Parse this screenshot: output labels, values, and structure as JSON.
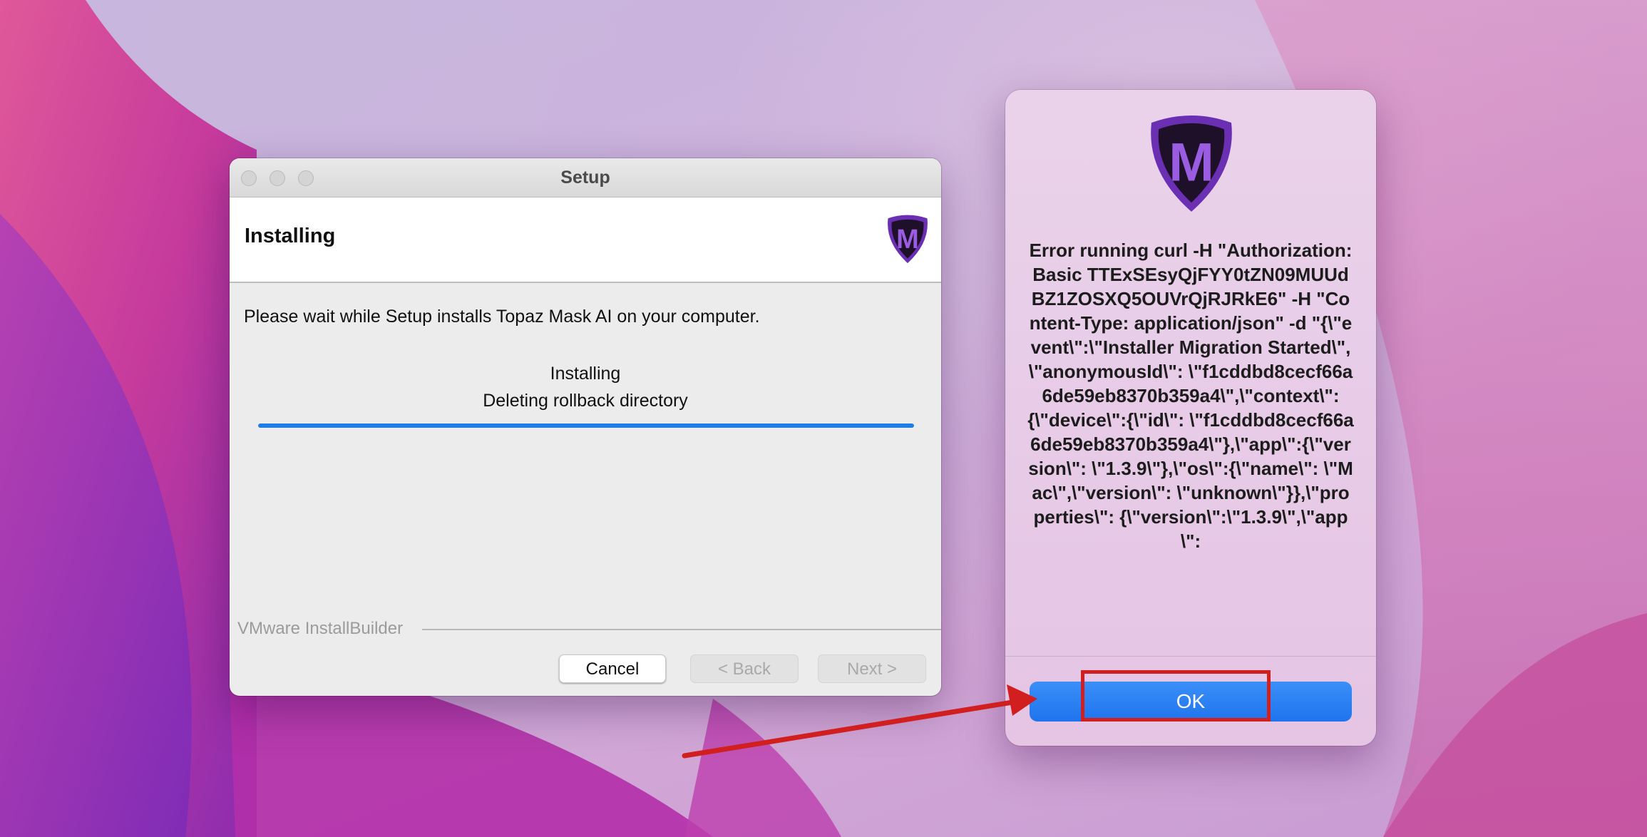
{
  "setup_window": {
    "title": "Setup",
    "header_title": "Installing",
    "wait_text": "Please wait while Setup installs Topaz Mask AI on your computer.",
    "status_line1": "Installing",
    "status_line2": "Deleting rollback directory",
    "progress_percent": 100,
    "brand": "VMware InstallBuilder",
    "buttons": {
      "cancel": "Cancel",
      "back": "< Back",
      "next": "Next >"
    },
    "logo_letter": "M"
  },
  "alert_dialog": {
    "logo_letter": "M",
    "message": "Error running curl -H \"Authorization: Basic TTExSEsyQjFYY0tZN09MUUdBZ1ZOSXQ5OUVrQjRJRkE6\" -H \"Content-Type: application/json\" -d \"{\\\"event\\\":\\\"Installer Migration Started\\\", \\\"anonymousId\\\": \\\"f1cddbd8cecf66a6de59eb8370b359a4\\\",\\\"context\\\": {\\\"device\\\":{\\\"id\\\": \\\"f1cddbd8cecf66a6de59eb8370b359a4\\\"},\\\"app\\\":{\\\"version\\\": \\\"1.3.9\\\"},\\\"os\\\":{\\\"name\\\": \\\"Mac\\\",\\\"version\\\": \\\"unknown\\\"}},\\\"properties\\\": {\\\"version\\\":\\\"1.3.9\\\",\\\"app\\\":",
    "ok_label": "OK"
  },
  "colors": {
    "accent_blue": "#1f74ee",
    "annotation_red": "#d11e1e",
    "logo_purple": "#6b2fb3"
  }
}
